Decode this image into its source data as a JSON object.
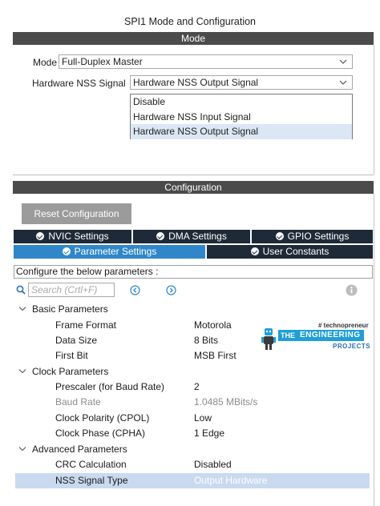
{
  "window": {
    "title": "SPI1 Mode and Configuration"
  },
  "mode_section": {
    "header": "Mode",
    "mode_label": "Mode",
    "mode_value": "Full-Duplex Master",
    "nss_label": "Hardware NSS Signal",
    "nss_value": "Hardware NSS Output Signal",
    "nss_options": [
      "Disable",
      "Hardware NSS Input Signal",
      "Hardware NSS Output Signal"
    ],
    "nss_selected_option": "Hardware NSS Output Signal"
  },
  "config_section": {
    "header": "Configuration",
    "reset_label": "Reset Configuration",
    "tabs_row1": [
      {
        "label": "NVIC Settings",
        "active": false
      },
      {
        "label": "DMA Settings",
        "active": false
      },
      {
        "label": "GPIO Settings",
        "active": false
      }
    ],
    "tabs_row2": [
      {
        "label": "Parameter Settings",
        "active": true
      },
      {
        "label": "User Constants",
        "active": false
      }
    ],
    "configure_text": "Configure the below parameters :",
    "search_placeholder": "Search (Crtl+F)",
    "groups": [
      {
        "name": "Basic Parameters",
        "params": [
          {
            "name": "Frame Format",
            "value": "Motorola"
          },
          {
            "name": "Data Size",
            "value": "8 Bits"
          },
          {
            "name": "First Bit",
            "value": "MSB First"
          }
        ]
      },
      {
        "name": "Clock Parameters",
        "params": [
          {
            "name": "Prescaler (for Baud Rate)",
            "value": "2"
          },
          {
            "name": "Baud Rate",
            "value": "1.0485 MBits/s",
            "disabled": true
          },
          {
            "name": "Clock Polarity (CPOL)",
            "value": "Low"
          },
          {
            "name": "Clock Phase (CPHA)",
            "value": "1 Edge"
          }
        ]
      },
      {
        "name": "Advanced Parameters",
        "params": [
          {
            "name": "CRC Calculation",
            "value": "Disabled"
          },
          {
            "name": "NSS Signal Type",
            "value": "Output Hardware",
            "highlighted": true
          }
        ]
      }
    ]
  },
  "watermark": {
    "tag": "# technopreneur",
    "the": "THE",
    "engineering": "ENGINEERING",
    "projects": "PROJECTS"
  },
  "colors": {
    "section_bar": "#4b4b4b",
    "tab_dark": "#1f2a38",
    "tab_active": "#2f87c9",
    "row_highlight": "#c9d9ef",
    "dropdown_selected": "#dbe7f5"
  }
}
